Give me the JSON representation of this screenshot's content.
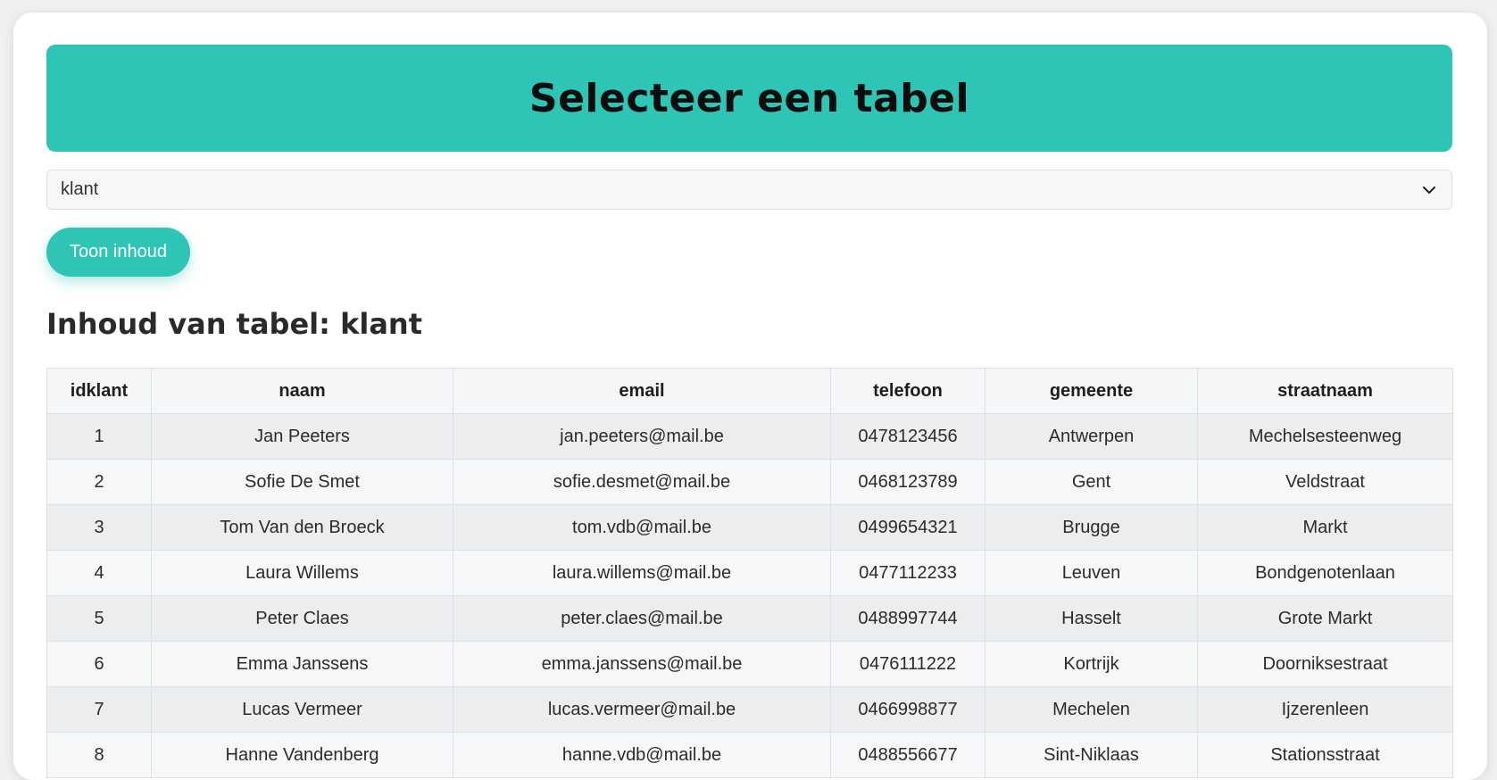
{
  "header": {
    "title": "Selecteer een tabel"
  },
  "selector": {
    "value": "klant"
  },
  "button": {
    "label": "Toon inhoud"
  },
  "section": {
    "title": "Inhoud van tabel: klant"
  },
  "table": {
    "columns": [
      "idklant",
      "naam",
      "email",
      "telefoon",
      "gemeente",
      "straatnaam"
    ],
    "rows": [
      [
        "1",
        "Jan Peeters",
        "jan.peeters@mail.be",
        "0478123456",
        "Antwerpen",
        "Mechelsesteenweg"
      ],
      [
        "2",
        "Sofie De Smet",
        "sofie.desmet@mail.be",
        "0468123789",
        "Gent",
        "Veldstraat"
      ],
      [
        "3",
        "Tom Van den Broeck",
        "tom.vdb@mail.be",
        "0499654321",
        "Brugge",
        "Markt"
      ],
      [
        "4",
        "Laura Willems",
        "laura.willems@mail.be",
        "0477112233",
        "Leuven",
        "Bondgenotenlaan"
      ],
      [
        "5",
        "Peter Claes",
        "peter.claes@mail.be",
        "0488997744",
        "Hasselt",
        "Grote Markt"
      ],
      [
        "6",
        "Emma Janssens",
        "emma.janssens@mail.be",
        "0476111222",
        "Kortrijk",
        "Doorniksestraat"
      ],
      [
        "7",
        "Lucas Vermeer",
        "lucas.vermeer@mail.be",
        "0466998877",
        "Mechelen",
        "Ijzerenleen"
      ],
      [
        "8",
        "Hanne Vandenberg",
        "hanne.vdb@mail.be",
        "0488556677",
        "Sint-Niklaas",
        "Stationsstraat"
      ]
    ]
  },
  "colors": {
    "accent": "#2ec4b6"
  },
  "icons": {
    "dropdown": "chevron-down-icon"
  }
}
